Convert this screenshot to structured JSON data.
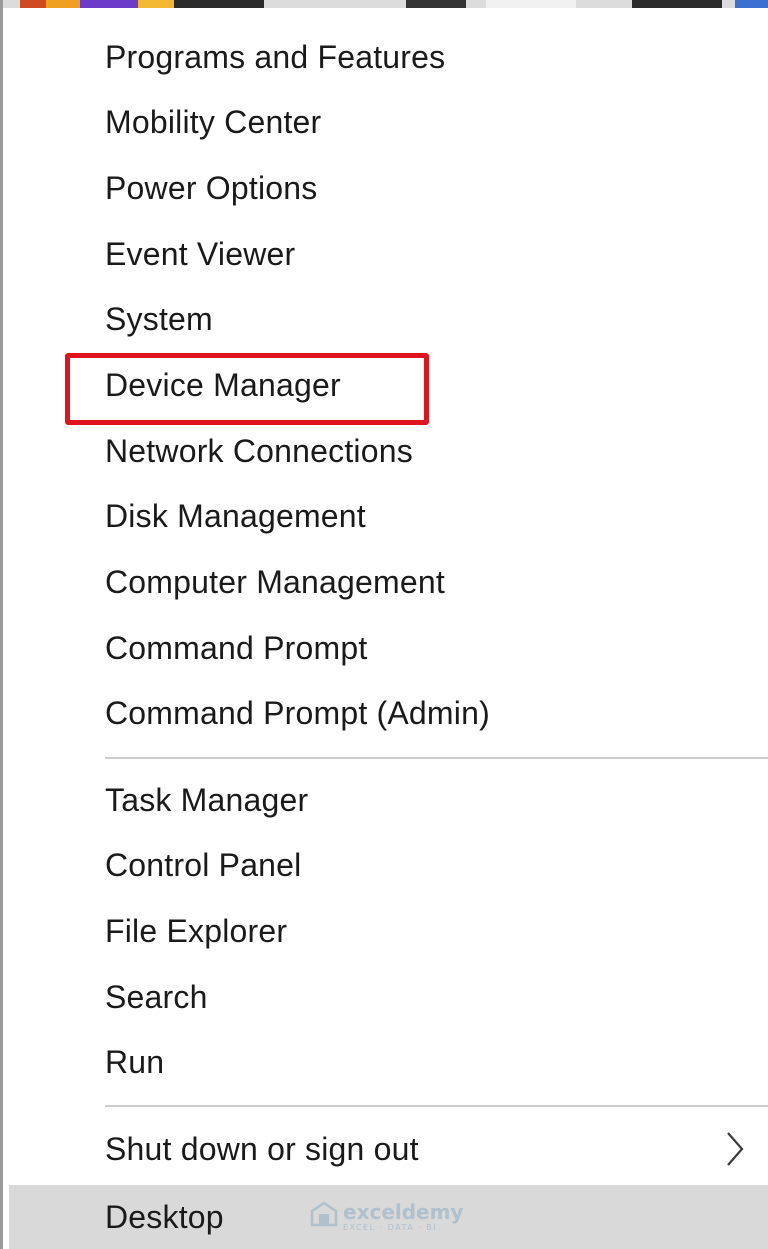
{
  "menu": {
    "group1": [
      {
        "id": "programs-and-features",
        "label": "Programs and Features"
      },
      {
        "id": "mobility-center",
        "label": "Mobility Center"
      },
      {
        "id": "power-options",
        "label": "Power Options"
      },
      {
        "id": "event-viewer",
        "label": "Event Viewer"
      },
      {
        "id": "system",
        "label": "System"
      },
      {
        "id": "device-manager",
        "label": "Device Manager"
      },
      {
        "id": "network-connections",
        "label": "Network Connections"
      },
      {
        "id": "disk-management",
        "label": "Disk Management"
      },
      {
        "id": "computer-management",
        "label": "Computer Management"
      },
      {
        "id": "command-prompt",
        "label": "Command Prompt"
      },
      {
        "id": "command-prompt-admin",
        "label": "Command Prompt (Admin)"
      }
    ],
    "group2": [
      {
        "id": "task-manager",
        "label": "Task Manager"
      },
      {
        "id": "control-panel",
        "label": "Control Panel"
      },
      {
        "id": "file-explorer",
        "label": "File Explorer"
      },
      {
        "id": "search",
        "label": "Search"
      },
      {
        "id": "run",
        "label": "Run"
      }
    ],
    "group3": [
      {
        "id": "shut-down-or-sign-out",
        "label": "Shut down or sign out",
        "has_submenu": true
      },
      {
        "id": "desktop",
        "label": "Desktop",
        "hovered": true
      }
    ]
  },
  "highlighted_item": "device-manager",
  "watermark": {
    "name": "exceldemy",
    "tagline": "EXCEL · DATA · BI"
  },
  "colors": {
    "highlight_border": "#e0141e",
    "hover_bg": "#d9d9d9",
    "separator": "#cfcfcf",
    "text": "#1a1a1a"
  },
  "icons": {
    "submenu": "chevron-right-icon",
    "watermark_logo": "exceldemy-logo-icon"
  }
}
